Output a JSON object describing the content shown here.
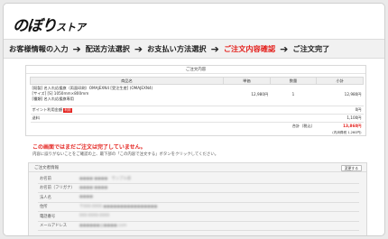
{
  "logo": {
    "big": "のぼり",
    "small": "ストア"
  },
  "steps": [
    {
      "label": "お客様情報の入力",
      "active": false
    },
    {
      "label": "配送方法選択",
      "active": false
    },
    {
      "label": "お支払い方法選択",
      "active": false
    },
    {
      "label": "ご注文内容確認",
      "active": true
    },
    {
      "label": "ご注文完了",
      "active": false
    }
  ],
  "arrow": "➔",
  "order": {
    "title": "ご注文内容",
    "headers": {
      "product": "商品名",
      "price": "単価",
      "qty": "数量",
      "subtotal": "小計"
    },
    "item": {
      "line1": "[既製] 名入れ応援旗（両面印刷）OMAJEXN4 [受注生産] (OMAJEXN4)",
      "line2": "[サイズ] [S] 1050mm×800mm",
      "line3": "[種類] 名入れ応援旗専用",
      "price": "12,980円",
      "qty": "1",
      "subtotal": "12,980円"
    },
    "points_label": "ポイント利用金額",
    "points_tag": "利用",
    "points_value": "0円",
    "shipping_label": "送料",
    "shipping_value": "1,100円",
    "total_label": "合計（税込）",
    "total_value": "13,860円",
    "tax_note": "(内消費税 1,260円)"
  },
  "warning": "この画面ではまだご注文は完了していません。",
  "note": "内容に誤りがないことをご確認の上、最下部の「この内容で注文する」ボタンをクリックしてください。",
  "customer": {
    "title": "ご注文者情報",
    "edit_button": "変更する",
    "rows": [
      {
        "key": "お名前",
        "value": "●●●● ●●●●　サンプル様"
      },
      {
        "key": "お名前（フリガナ）",
        "value": "●●●● ●●●●"
      },
      {
        "key": "法人名",
        "value": "●●●●"
      },
      {
        "key": "住所",
        "value": "〒000-0000 ●●●●●●●●●●●●●●●●"
      },
      {
        "key": "電話番号",
        "value": "000-0000-0000"
      },
      {
        "key": "メールアドレス",
        "value": "●●●●●●@●●●●.com"
      }
    ]
  },
  "colors": {
    "accent": "#e4221e",
    "text": "#222222",
    "panel": "#f4f4f4"
  }
}
